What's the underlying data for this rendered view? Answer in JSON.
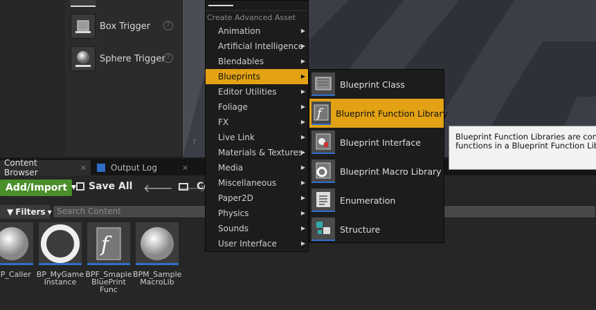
{
  "place_actors": {
    "items": [
      {
        "label": "Box Trigger",
        "icon": "box-trigger-icon"
      },
      {
        "label": "Sphere Trigger",
        "icon": "sphere-trigger-icon"
      }
    ],
    "help_glyph": "?"
  },
  "tabs": [
    {
      "label": "Content Browser",
      "icon": "content-browser-icon",
      "close": "✕"
    },
    {
      "label": "Output Log",
      "icon": "output-log-icon",
      "close": "✕"
    }
  ],
  "toolbar": {
    "add_import_label": "Add/Import",
    "save_all_label": "Save All",
    "folder_label": "Co"
  },
  "filters": {
    "label": "Filters"
  },
  "search": {
    "placeholder": "Search Content"
  },
  "assets": [
    {
      "label": "BP_Caller"
    },
    {
      "label": "BP_MyGame Instance"
    },
    {
      "label": "BPF_Smaple BluePrint Func"
    },
    {
      "label": "BPM_Sample MacroLib"
    }
  ],
  "context_menu": {
    "header": "Create Advanced Asset",
    "items": [
      {
        "label": "Animation",
        "highlighted": false
      },
      {
        "label": "Artificial Intelligence",
        "highlighted": false
      },
      {
        "label": "Blendables",
        "highlighted": false
      },
      {
        "label": "Blueprints",
        "highlighted": true
      },
      {
        "label": "Editor Utilities",
        "highlighted": false
      },
      {
        "label": "Foliage",
        "highlighted": false
      },
      {
        "label": "FX",
        "highlighted": false
      },
      {
        "label": "Live Link",
        "highlighted": false
      },
      {
        "label": "Materials & Textures",
        "highlighted": false
      },
      {
        "label": "Media",
        "highlighted": false
      },
      {
        "label": "Miscellaneous",
        "highlighted": false
      },
      {
        "label": "Paper2D",
        "highlighted": false
      },
      {
        "label": "Physics",
        "highlighted": false
      },
      {
        "label": "Sounds",
        "highlighted": false
      },
      {
        "label": "User Interface",
        "highlighted": false
      }
    ]
  },
  "blueprints_submenu": {
    "items": [
      {
        "label": "Blueprint Class",
        "icon": "blueprint-class-icon",
        "highlighted": false
      },
      {
        "label": "Blueprint Function Library",
        "icon": "function-library-icon",
        "highlighted": true
      },
      {
        "label": "Blueprint Interface",
        "icon": "blueprint-interface-icon",
        "highlighted": false
      },
      {
        "label": "Blueprint Macro Library",
        "icon": "macro-library-icon",
        "highlighted": false
      },
      {
        "label": "Enumeration",
        "icon": "enumeration-icon",
        "highlighted": false
      },
      {
        "label": "Structure",
        "icon": "structure-icon",
        "highlighted": false
      }
    ]
  },
  "tooltip": {
    "line1": "Blueprint Function Libraries are conta",
    "line2": "functions in a Blueprint Function Libra"
  },
  "colors": {
    "highlight": "#e3a214",
    "add_button": "#4a8f2a",
    "asset_underline": "#2e6fcf"
  }
}
